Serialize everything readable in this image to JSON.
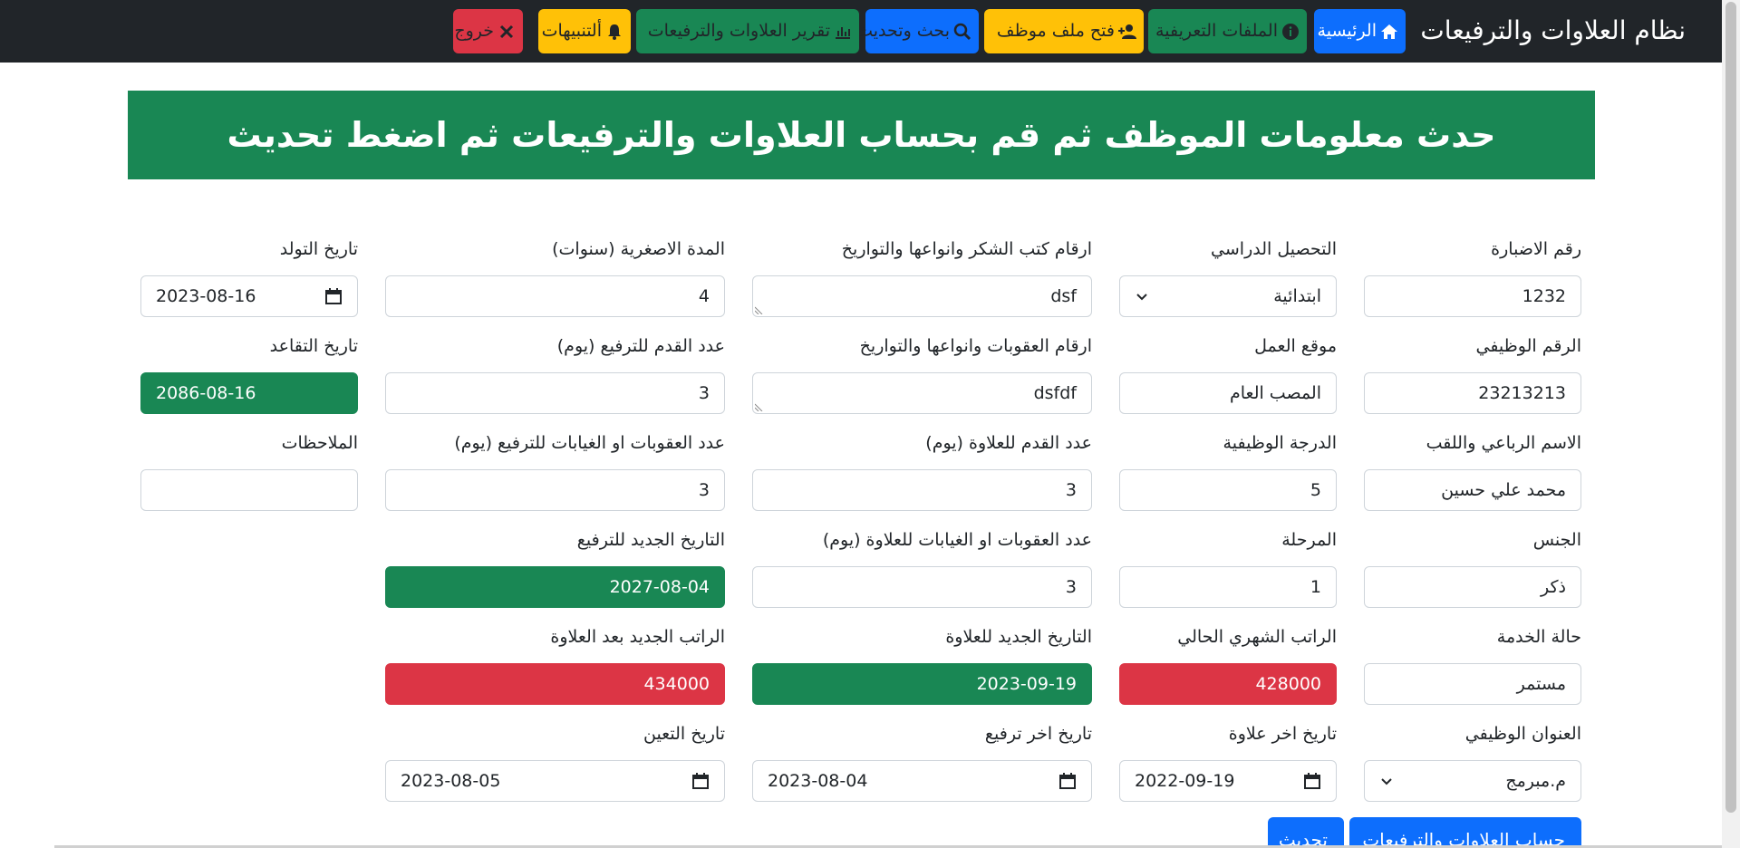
{
  "app": {
    "title": "نظام العلاوات والترفيعات"
  },
  "nav": {
    "home": "الرئيسية",
    "profiles": "الملفات التعريفية",
    "open_file": "فتح ملف موظف",
    "search": "بحث وتحديث",
    "report": "تقرير العلاوات والترفيعات",
    "alerts": "ألتنبيهات",
    "logout": "خروج"
  },
  "banner": {
    "text": "حدث معلومات الموظف ثم قم بحساب العلاوات والترفيعات ثم اضغط تحديث"
  },
  "fields": {
    "file_no": {
      "label": "رقم الاضبارة",
      "value": "1232"
    },
    "education": {
      "label": "التحصيل الدراسي",
      "value": "ابتدائية"
    },
    "thanks": {
      "label": "ارقام كتب الشكر وانواعها والتواريخ",
      "value": "dsf"
    },
    "min_period": {
      "label": "المدة الاصغرية (سنوات)",
      "value": "4"
    },
    "birth": {
      "label": "تاريخ التولد",
      "value": "2023-08-16"
    },
    "job_no": {
      "label": "الرقم الوظيفي",
      "value": "23213213"
    },
    "workplace": {
      "label": "موقع العمل",
      "value": "المصب العام"
    },
    "penalties": {
      "label": "ارقام العقوبات وانواعها والتواريخ",
      "value": "dsfdf"
    },
    "seniority_promo": {
      "label": "عدد القدم للترفيع (يوم)",
      "value": "3"
    },
    "retire": {
      "label": "تاريخ التقاعد",
      "value": "2086-08-16"
    },
    "full_name": {
      "label": "الاسم الرباعي واللقب",
      "value": "محمد علي حسين"
    },
    "grade": {
      "label": "الدرجة الوظيفية",
      "value": "5"
    },
    "seniority_bonus": {
      "label": "عدد القدم للعلاوة (يوم)",
      "value": "3"
    },
    "absence_promo": {
      "label": "عدد العقوبات او الغيابات للترفيع (يوم)",
      "value": "3"
    },
    "notes": {
      "label": "الملاحظات",
      "value": ""
    },
    "gender": {
      "label": "الجنس",
      "value": "ذكر"
    },
    "stage": {
      "label": "المرحلة",
      "value": "1"
    },
    "absence_bonus": {
      "label": "عدد العقوبات او الغيابات للعلاوة (يوم)",
      "value": "3"
    },
    "new_promo_date": {
      "label": "التاريخ الجديد للترفيع",
      "value": "2027-08-04"
    },
    "service": {
      "label": "حالة الخدمة",
      "value": "مستمر"
    },
    "salary": {
      "label": "الراتب الشهري الحالي",
      "value": "428000"
    },
    "new_bonus_date": {
      "label": "التاريخ الجديد للعلاوة",
      "value": "2023-09-19"
    },
    "new_salary": {
      "label": "الراتب الجديد بعد العلاوة",
      "value": "434000"
    },
    "job_title": {
      "label": "العنوان الوظيفي",
      "value": "م.مبرمج"
    },
    "last_bonus": {
      "label": "تاريخ اخر علاوة",
      "value": "2022-09-19"
    },
    "last_promo": {
      "label": "تاريخ اخر ترفيع",
      "value": "2023-08-04"
    },
    "hire_date": {
      "label": "تاريخ التعين",
      "value": "2023-08-05"
    }
  },
  "actions": {
    "calculate": "حساب العلاوات والترفيعات",
    "update": "تحديث"
  },
  "colors": {
    "navbar": "#212529",
    "blue": "#0d6efd",
    "green": "#198754",
    "yellow": "#ffc107",
    "red": "#dc3545"
  }
}
